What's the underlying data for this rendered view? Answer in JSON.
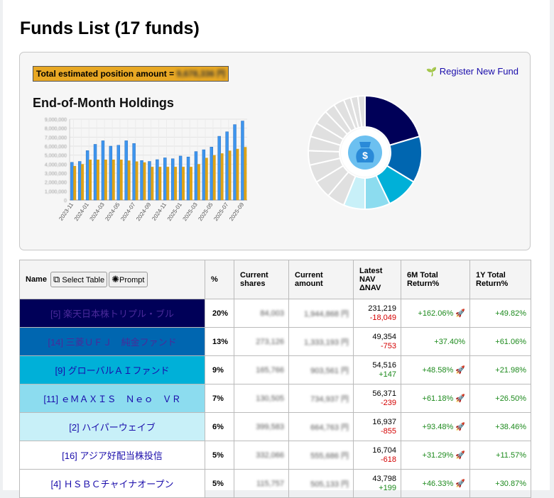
{
  "page": {
    "title": "Funds List (17 funds)"
  },
  "summary": {
    "total_label": "Total estimated position amount =",
    "total_value": "9,678,336 円",
    "register_label": "Register New Fund",
    "holdings_title": "End-of-Month Holdings"
  },
  "table": {
    "headers": {
      "name": "Name",
      "select_table": "Select Table",
      "prompt": "Prompt",
      "pct": "%",
      "shares": "Current shares",
      "amount": "Current amount",
      "nav": "Latest NAV ΔNAV",
      "ret6m": "6M Total Return%",
      "ret1y": "1Y Total Return%"
    },
    "rows": [
      {
        "name": "[5] 楽天日本株トリプル・ブル",
        "pct": "20%",
        "shares": "84,003",
        "amount": "1,944,868 円",
        "nav": "231,219",
        "dnav": "-18,049",
        "ret6m": "+162.06% 🚀",
        "ret1y": "+49.82%",
        "bg": "#000058",
        "fg": "#4a2a9a"
      },
      {
        "name": "[14] 三菱ＵＦＪ　純金ファンド",
        "pct": "13%",
        "shares": "273,126",
        "amount": "1,333,193 円",
        "nav": "49,354",
        "dnav": "-753",
        "ret6m": "+37.40%",
        "ret1y": "+61.06%",
        "bg": "#0066b0",
        "fg": "#4a2a9a"
      },
      {
        "name": "[9] グローバルＡＩファンド",
        "pct": "9%",
        "shares": "165,766",
        "amount": "903,561 円",
        "nav": "54,516",
        "dnav": "+147",
        "ret6m": "+48.58% 🚀",
        "ret1y": "+21.98%",
        "bg": "#00b0d8",
        "fg": "#1a0dab"
      },
      {
        "name": "[11] ｅＭＡＸＩＳ　Ｎｅｏ　ＶＲ",
        "pct": "7%",
        "shares": "130,505",
        "amount": "734,937 円",
        "nav": "56,371",
        "dnav": "-239",
        "ret6m": "+61.18% 🚀",
        "ret1y": "+26.50%",
        "bg": "#8cdcef",
        "fg": "#1a0dab"
      },
      {
        "name": "[2] ハイパーウェイブ",
        "pct": "6%",
        "shares": "399,583",
        "amount": "664,763 円",
        "nav": "16,937",
        "dnav": "-855",
        "ret6m": "+93.48% 🚀",
        "ret1y": "+38.46%",
        "bg": "#c8f0f8",
        "fg": "#1a0dab"
      },
      {
        "name": "[16] アジア好配当株投信",
        "pct": "5%",
        "shares": "332,066",
        "amount": "555,686 円",
        "nav": "16,704",
        "dnav": "-618",
        "ret6m": "+31.29% 🚀",
        "ret1y": "+11.57%",
        "bg": "#ffffff",
        "fg": "#1a0dab"
      },
      {
        "name": "[4] ＨＳＢＣチャイナオープン",
        "pct": "5%",
        "shares": "115,757",
        "amount": "505,133 円",
        "nav": "43,798",
        "dnav": "+199",
        "ret6m": "+46.33% 🚀",
        "ret1y": "+30.87%",
        "bg": "#ffffff",
        "fg": "#1a0dab"
      }
    ]
  },
  "chart_data": [
    {
      "type": "bar",
      "title": "End-of-Month Holdings",
      "ylim": [
        0,
        9000000
      ],
      "yticks": [
        "0",
        "1,000,000",
        "2,000,000",
        "3,000,000",
        "4,000,000",
        "5,000,000",
        "6,000,000",
        "7,000,000",
        "8,000,000",
        "9,000,000"
      ],
      "categories": [
        "2023-11",
        "2023-12",
        "2024-01",
        "2024-02",
        "2024-03",
        "2024-04",
        "2024-05",
        "2024-06",
        "2024-07",
        "2024-08",
        "2024-09",
        "2024-10",
        "2024-11",
        "2024-12",
        "2025-01",
        "2025-02",
        "2025-03",
        "2025-04",
        "2025-05",
        "2025-06",
        "2025-07",
        "2025-08",
        "2025-09",
        "2025-10"
      ],
      "xtick_labels": [
        "2023-11",
        "",
        "2024-01",
        "",
        "2024-03",
        "",
        "2024-05",
        "",
        "2024-07",
        "",
        "2024-09",
        "",
        "2024-11",
        "",
        "2025-01",
        "",
        "2025-03",
        "",
        "2025-05",
        "",
        "2025-07",
        "",
        "2025-09",
        ""
      ],
      "series": [
        {
          "values": [
            4200000,
            4300000,
            5500000,
            6200000,
            6600000,
            6000000,
            6100000,
            6600000,
            6300000,
            4400000,
            4300000,
            4500000,
            4700000,
            4600000,
            4900000,
            4800000,
            5400000,
            5600000,
            5900000,
            7100000,
            7600000,
            8400000,
            8800000,
            8800000
          ],
          "color": "#3d95ee"
        },
        {
          "values": [
            3800000,
            4000000,
            4500000,
            4500000,
            4500000,
            4500000,
            4500000,
            4400000,
            4300000,
            4200000,
            3700000,
            3700000,
            3700000,
            3700000,
            3700000,
            3700000,
            4000000,
            4700000,
            5000000,
            5200000,
            5500000,
            5700000,
            5900000,
            5900000
          ],
          "color": "#dea316"
        }
      ]
    },
    {
      "type": "pie",
      "style": "donut",
      "center_icon": "money-bag-icon",
      "values": [
        20,
        13,
        9,
        7,
        6,
        5,
        5,
        5,
        4,
        4,
        4,
        4,
        3,
        3,
        2,
        2,
        2
      ],
      "colors": [
        "#000058",
        "#0066b0",
        "#00b0d8",
        "#8cdcef",
        "#c8f0f8",
        "#e0e0e0",
        "#e0e0e0",
        "#e0e0e0",
        "#e0e0e0",
        "#e0e0e0",
        "#e0e0e0",
        "#e0e0e0",
        "#e0e0e0",
        "#e0e0e0",
        "#e0e0e0",
        "#e0e0e0",
        "#e0e0e0"
      ]
    }
  ]
}
